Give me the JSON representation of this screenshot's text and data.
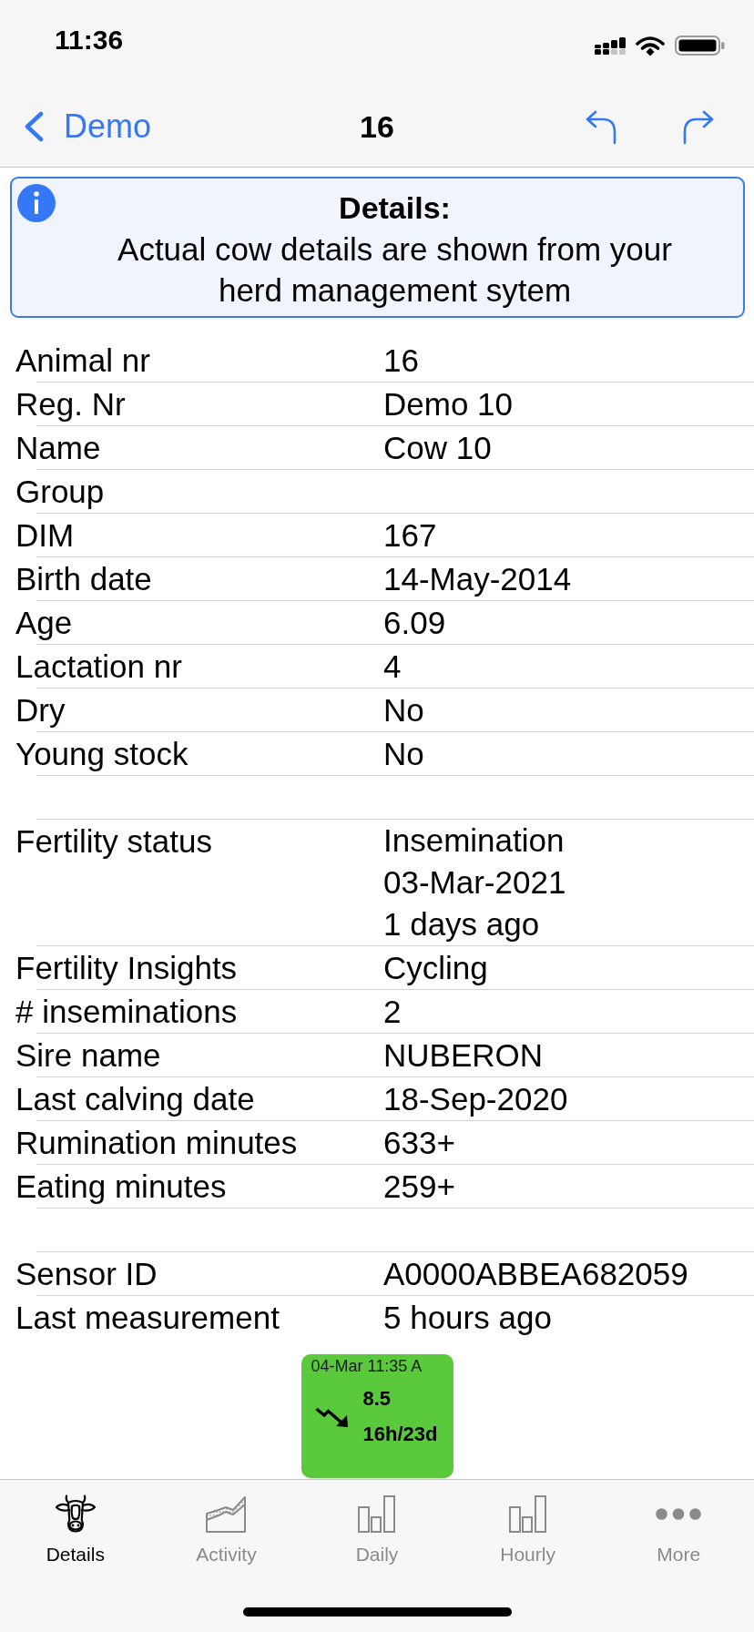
{
  "status_bar": {
    "time": "11:36"
  },
  "nav_bar": {
    "back_label": "Demo",
    "title": "16"
  },
  "info_banner": {
    "title": "Details:",
    "message": "Actual cow details are shown from your herd management sytem"
  },
  "details": {
    "sections": [
      {
        "rows": [
          {
            "label": "Animal nr",
            "value": "16"
          },
          {
            "label": "Reg. Nr",
            "value": "Demo 10"
          },
          {
            "label": "Name",
            "value": "Cow 10"
          },
          {
            "label": "Group"
          },
          {
            "label": "DIM",
            "value": "167"
          },
          {
            "label": "Birth date",
            "value": "14-May-2014"
          },
          {
            "label": "Age",
            "value": "6.09"
          },
          {
            "label": "Lactation nr",
            "value": "4"
          },
          {
            "label": "Dry",
            "value": "No"
          },
          {
            "label": "Young stock",
            "value": "No"
          }
        ]
      },
      {
        "rows": [
          {
            "label": "Fertility status",
            "value_lines": [
              "Insemination",
              "03-Mar-2021",
              "1 days ago"
            ]
          },
          {
            "label": "Fertility Insights",
            "value": "Cycling"
          },
          {
            "label": "# inseminations",
            "value": "2"
          },
          {
            "label": "Sire name",
            "value": "NUBERON"
          },
          {
            "label": "Last calving date",
            "value": "18-Sep-2020"
          },
          {
            "label": "Rumination minutes",
            "value": "633+"
          },
          {
            "label": "Eating minutes",
            "value": "259+"
          }
        ]
      },
      {
        "rows": [
          {
            "label": "Sensor ID",
            "value": "A0000ABBEA682059"
          },
          {
            "label": "Last measurement",
            "value": "5 hours ago"
          }
        ]
      }
    ]
  },
  "measurement_tile": {
    "timestamp": "04-Mar 11:35 A",
    "value": "8.5",
    "period": "16h/23d"
  },
  "tab_bar": {
    "tabs": [
      {
        "label": "Details",
        "selected": true
      },
      {
        "label": "Activity",
        "selected": false
      },
      {
        "label": "Daily",
        "selected": false
      },
      {
        "label": "Hourly",
        "selected": false
      },
      {
        "label": "More",
        "selected": false
      }
    ]
  }
}
